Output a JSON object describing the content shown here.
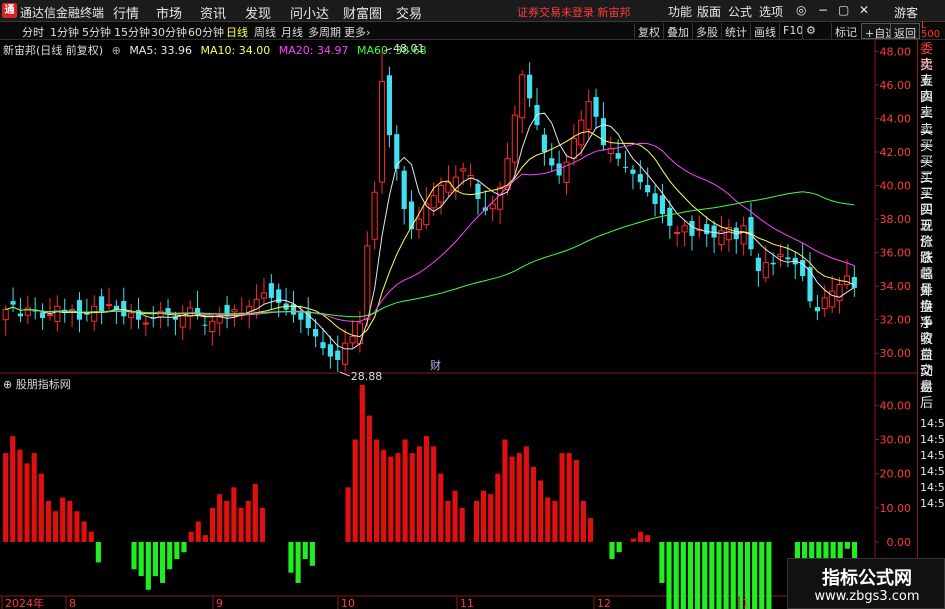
{
  "app": {
    "title": "通达信金融终端",
    "logo": "通",
    "main_menu": [
      "行情",
      "市场",
      "资讯",
      "发现",
      "问小达",
      "财富圈",
      "交易"
    ],
    "status_warning": "证券交易未登录  新宙邦",
    "right_menu": [
      "功能",
      "版面",
      "公式",
      "选项"
    ],
    "guest": "游客",
    "window_icons": [
      "user-icon",
      "minimize-icon",
      "restore-icon",
      "close-icon"
    ]
  },
  "toolbar": {
    "periods": [
      "分时",
      "1分钟",
      "5分钟",
      "15分钟",
      "30分钟",
      "60分钟",
      "日线",
      "周线",
      "月线",
      "多周期",
      "更多"
    ],
    "active_period": "日线",
    "tools": [
      "复权",
      "叠加",
      "多股",
      "统计",
      "画线",
      "F10",
      "标记",
      "+自选",
      "返回"
    ],
    "scale_label": "L 500"
  },
  "chart_header": {
    "stock": "新宙邦(日线 前复权)",
    "ma5": "MA5: 33.96",
    "ma10": "MA10: 34.00",
    "ma20": "MA20: 34.97",
    "ma60": "MA60: 38.68"
  },
  "indicator_header": "股朋指标网",
  "annotations": {
    "high": "48.01",
    "low": "28.88",
    "fin_marker": "财"
  },
  "x_axis_labels": [
    "2024年",
    "8",
    "9",
    "10",
    "11",
    "12",
    "1"
  ],
  "side_panel": {
    "labels": [
      "委比",
      "卖五",
      "卖四",
      "卖三",
      "卖二",
      "卖一",
      "买一",
      "买二",
      "买三",
      "买四",
      "买五",
      "现价",
      "涨跌",
      "涨幅",
      "总量",
      "外盘",
      "换手",
      "净资",
      "收益",
      "自动",
      "交易",
      "盘后"
    ],
    "times": [
      "14:56",
      "14:56",
      "14:56",
      "14:56",
      "14:56",
      "14:56"
    ]
  },
  "watermark": {
    "title": "指标公式网",
    "url": "www.zbgs3.com"
  },
  "colors": {
    "up": "#ff2a2a",
    "down": "#40e0f0",
    "hist_up": "#e01010",
    "hist_down": "#20ee20",
    "ma5": "#e8e8e8",
    "ma10": "#ffff50",
    "ma20": "#ff40ff",
    "ma60": "#40ff40"
  },
  "chart_data": [
    {
      "type": "candlestick",
      "title": "新宙邦(日线 前复权)",
      "ylim": [
        29,
        48.5
      ],
      "y_ticks": [
        30,
        32,
        34,
        36,
        38,
        40,
        42,
        44,
        46,
        48
      ],
      "y_tick_labels": [
        "30.00",
        "32.00",
        "34.00",
        "36.00",
        "38.00",
        "40.00",
        "42.00",
        "44.00",
        "46.00",
        "48.00"
      ],
      "x": [
        "2024年",
        "8",
        "9",
        "10",
        "11",
        "12",
        "1"
      ],
      "candles_note": "open/high/low/close per trading day, approx. read from the chart",
      "close": [
        32.6,
        32.9,
        32.2,
        32.7,
        32.5,
        32.1,
        32.3,
        32.8,
        32.4,
        32.6,
        32.0,
        32.3,
        32.8,
        32.5,
        32.9,
        32.6,
        32.2,
        32.4,
        32.0,
        31.8,
        32.1,
        32.5,
        32.3,
        32.0,
        32.4,
        32.7,
        32.3,
        31.7,
        31.9,
        32.3,
        32.2,
        32.6,
        32.4,
        32.8,
        33.2,
        33.6,
        33.3,
        33.0,
        32.6,
        32.3,
        32.0,
        31.5,
        31.0,
        30.3,
        29.8,
        29.6,
        30.6,
        31.0,
        31.8,
        36.4,
        39.6,
        46.2,
        43.0,
        41.0,
        38.6,
        37.4,
        38.0,
        38.9,
        39.4,
        40.0,
        40.2,
        40.5,
        41.0,
        40.6,
        39.2,
        38.5,
        38.9,
        39.9,
        41.6,
        44.2,
        46.6,
        45.2,
        43.6,
        42.0,
        41.2,
        40.6,
        41.4,
        42.8,
        43.9,
        45.0,
        44.1,
        42.4,
        42.2,
        41.6,
        41.1,
        40.7,
        40.2,
        39.6,
        38.9,
        38.3,
        37.6,
        37.2,
        37.6,
        37.0,
        37.4,
        37.1,
        36.9,
        37.3,
        37.5,
        36.8,
        37.6,
        36.2,
        34.9,
        35.4,
        35.3,
        35.9,
        35.6,
        35.3,
        34.6,
        33.1,
        32.5,
        33.3,
        33.7,
        34.1,
        34.6,
        33.9
      ],
      "series": [
        {
          "name": "MA5",
          "value": 33.96
        },
        {
          "name": "MA10",
          "value": 34.0
        },
        {
          "name": "MA20",
          "value": 34.97
        },
        {
          "name": "MA60",
          "value": 38.68
        }
      ],
      "annotations": [
        {
          "label": "48.01",
          "type": "high"
        },
        {
          "label": "28.88",
          "type": "low"
        }
      ]
    },
    {
      "type": "bar",
      "title": "股朋指标网",
      "ylim": [
        -17,
        48
      ],
      "y_ticks": [
        40,
        30,
        20,
        10,
        0,
        -10
      ],
      "y_tick_labels": [
        "40.00",
        "30.00",
        "20.00",
        "10.00",
        "0.00",
        "-10.00"
      ],
      "values": [
        26,
        31,
        27,
        23,
        26,
        20,
        12,
        9,
        13,
        12,
        9,
        6,
        3,
        -6,
        0,
        0,
        0,
        0,
        -8,
        -10,
        -14,
        -10,
        -12,
        -8,
        -5,
        -3,
        3,
        6,
        2,
        10,
        14,
        12,
        16,
        10,
        12,
        17,
        10,
        0,
        0,
        0,
        -9,
        -12,
        -5,
        -7,
        0,
        0,
        0,
        0,
        16,
        30,
        46,
        37,
        30,
        27,
        25,
        26,
        30,
        26,
        28,
        31,
        28,
        20,
        12,
        15,
        10,
        0,
        12,
        15,
        14,
        20,
        30,
        25,
        26,
        28,
        22,
        18,
        13,
        12,
        26,
        26,
        24,
        12,
        7,
        0,
        0,
        -5,
        -3,
        0,
        1,
        3,
        2,
        0,
        -12,
        -25,
        -22,
        -25,
        -25,
        -22,
        -24,
        -25,
        -20,
        -20,
        -24,
        -27,
        -20,
        -22,
        -20,
        -24,
        0,
        0,
        0,
        -10,
        -8,
        -12,
        -15,
        -16,
        -5,
        -5,
        -2,
        -6
      ]
    }
  ]
}
